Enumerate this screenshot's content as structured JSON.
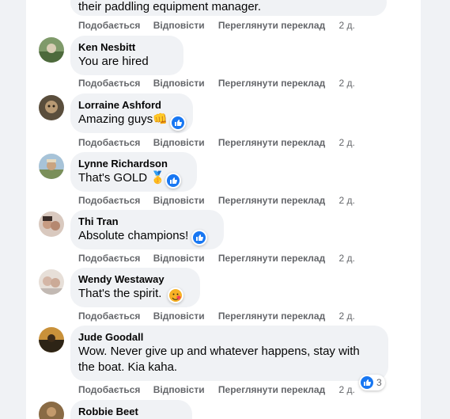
{
  "action_labels": {
    "like": "Подобається",
    "reply": "Відповісти",
    "translate": "Переглянути переклад",
    "time": "2 д."
  },
  "comments": [
    {
      "author": "",
      "text": "their paddling equipment manager.",
      "reaction": "none"
    },
    {
      "author": "Ken Nesbitt",
      "text": "You are hired",
      "reaction": "none"
    },
    {
      "author": "Lorraine Ashford",
      "text": "Amazing guys👊",
      "reaction": "like-icon"
    },
    {
      "author": "Lynne Richardson",
      "text": "That's GOLD 🥇",
      "reaction": "like-icon"
    },
    {
      "author": "Thi Tran",
      "text": "Absolute champions!",
      "reaction": "like-icon"
    },
    {
      "author": "Wendy Westaway",
      "text": "That's the spirit.",
      "reaction": "care-emoji"
    },
    {
      "author": "Jude Goodall",
      "text": "Wow. Never give up and whatever happens, stay with the boat. Kia kaha.",
      "reaction": "like-icon",
      "reaction_count": "3"
    },
    {
      "author": "Robbie Beet",
      "text": "",
      "reaction": "none"
    }
  ],
  "colors": {
    "accent": "#1877f2",
    "bubble": "#f0f2f5",
    "meta": "#65676b"
  }
}
